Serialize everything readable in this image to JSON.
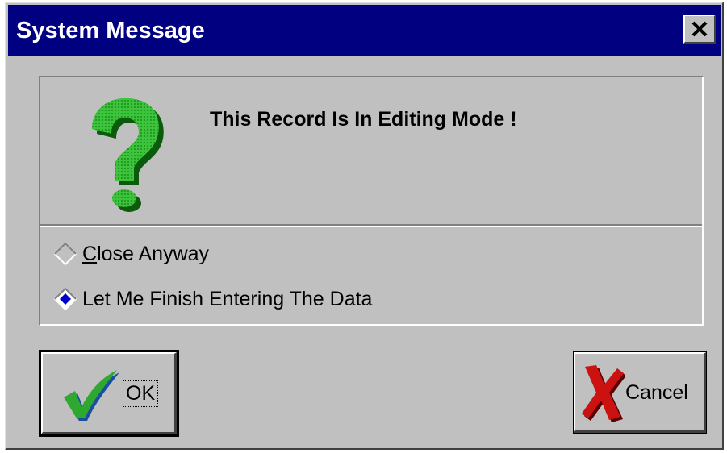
{
  "window": {
    "title": "System Message"
  },
  "message": {
    "text": "This Record Is In Editing Mode !"
  },
  "options": [
    {
      "label_first": "C",
      "label_rest": "lose Anyway",
      "selected": false
    },
    {
      "label_first": "",
      "label_rest": "Let Me Finish Entering The Data",
      "selected": true
    }
  ],
  "buttons": {
    "ok_label": "OK",
    "cancel_label": "Cancel"
  },
  "colors": {
    "titlebar": "#000080",
    "face": "#c0c0c0",
    "question_mark": "#22aa22",
    "check": "#2fa82f",
    "cross": "#cc1111",
    "radio_dot": "#0000cc"
  },
  "icons": {
    "question": "question-mark-icon",
    "close": "close-icon",
    "ok": "checkmark-icon",
    "cancel": "cross-icon"
  }
}
